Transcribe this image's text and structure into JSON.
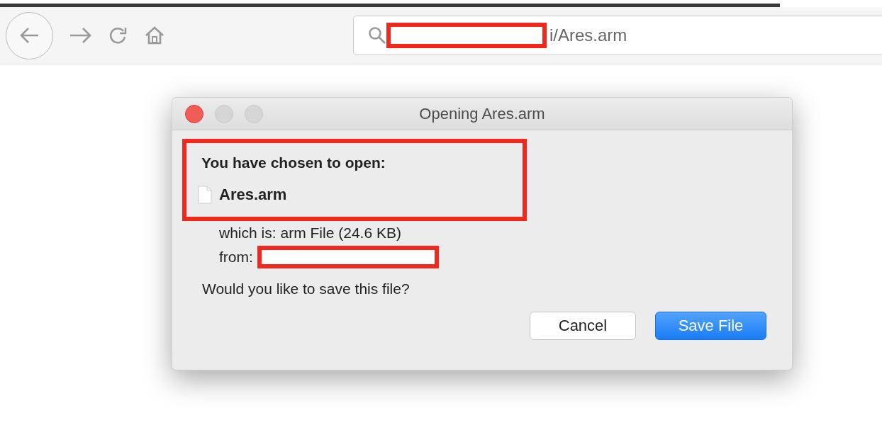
{
  "toolbar": {
    "url": {
      "value": "i/Ares.arm"
    }
  },
  "dialog": {
    "title": "Opening Ares.arm",
    "heading": "You have chosen to open:",
    "file_name": "Ares.arm",
    "type_label": "which is:",
    "type_value": "arm File (24.6 KB)",
    "from_label": "from:",
    "question": "Would you like to save this file?",
    "buttons": [
      {
        "label": "Cancel",
        "kind": "default"
      },
      {
        "label": "Save File",
        "kind": "primary"
      }
    ]
  }
}
